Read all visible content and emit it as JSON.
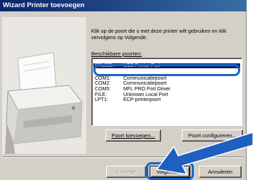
{
  "window": {
    "title": "Wizard Printer toevoegen"
  },
  "instruction": "Klik op de poort die u met deze printer wilt gebruiken en klik vervolgens op Volgende.",
  "ports_label": "Beschikbare poorten:",
  "ports": [
    {
      "port": "BRUSB:",
      "description": "USB Printer Port",
      "selected": true
    },
    {
      "port": "COM1:",
      "description": "Communicatiepoort",
      "selected": false
    },
    {
      "port": "COM2:",
      "description": "Communicatiepoort",
      "selected": false
    },
    {
      "port": "COM5:",
      "description": "MFL PRO Port Driver",
      "selected": false
    },
    {
      "port": "FILE:",
      "description": "Unknown Local Port",
      "selected": false
    },
    {
      "port": "LPT1:",
      "description": "ECP-printerpoort",
      "selected": false
    }
  ],
  "buttons": {
    "add_port": "Poort toevoegen...",
    "configure_port": "Poort configureren...",
    "back": "< Vorige",
    "next": "Volgende >",
    "cancel": "Annuleren"
  },
  "colors": {
    "title_bar": "#0a246a",
    "selection": "#0a246a",
    "highlight_annotation": "#1565c8",
    "dialog_face": "#d4d0c8"
  },
  "icons": {
    "illustration": "printer-illustration",
    "callout": "pointer-arrow"
  }
}
